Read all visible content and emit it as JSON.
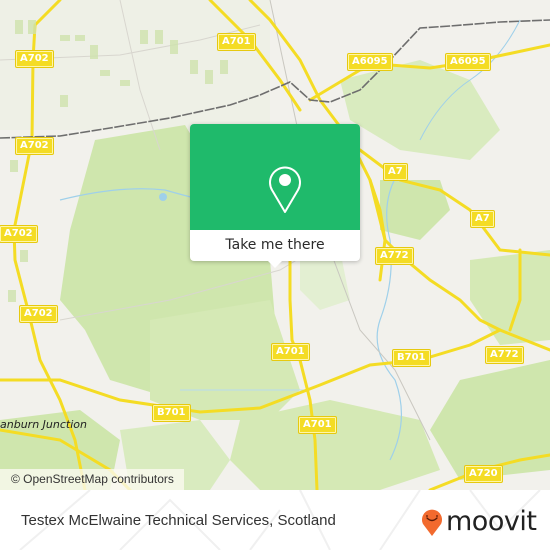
{
  "map": {
    "road_labels": [
      {
        "id": "a701-north",
        "text": "A701"
      },
      {
        "id": "a702-nw",
        "text": "A702"
      },
      {
        "id": "a702-w1",
        "text": "A702"
      },
      {
        "id": "a702-w2",
        "text": "A702"
      },
      {
        "id": "a702-w3",
        "text": "A702"
      },
      {
        "id": "a6095-1",
        "text": "A6095"
      },
      {
        "id": "a6095-2",
        "text": "A6095"
      },
      {
        "id": "a7-1",
        "text": "A7"
      },
      {
        "id": "a7-2",
        "text": "A7"
      },
      {
        "id": "a772-1",
        "text": "A772"
      },
      {
        "id": "a772-2",
        "text": "A772"
      },
      {
        "id": "a701-mid",
        "text": "A701"
      },
      {
        "id": "a701-south",
        "text": "A701"
      },
      {
        "id": "b701-east",
        "text": "B701"
      },
      {
        "id": "b701-west",
        "text": "B701"
      },
      {
        "id": "a720",
        "text": "A720"
      }
    ],
    "place_labels": [
      {
        "id": "junction",
        "text": "anburn Junction"
      }
    ],
    "attribution": "© OpenStreetMap contributors",
    "colors": {
      "land": "#f2f1ec",
      "park": "#cfe6ad",
      "road_major": "#f4dc24",
      "water": "#9fd0ea",
      "rail": "#6e6e6e"
    }
  },
  "popup": {
    "icon": "location-pin-icon",
    "button_label": "Take me there",
    "accent": "#1fba6b"
  },
  "footer": {
    "place_title": "Testex McElwaine Technical Services, Scotland",
    "brand": "moovit",
    "brand_color": "#f26a2e"
  }
}
